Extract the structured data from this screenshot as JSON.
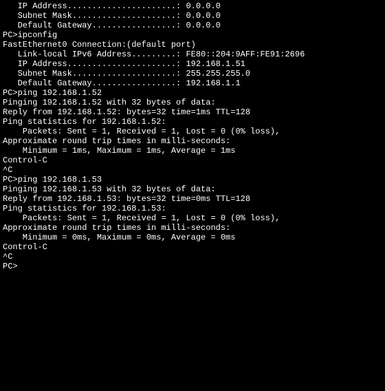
{
  "lines": {
    "l00": "",
    "l01": "   IP Address......................: 0.0.0.0",
    "l02": "   Subnet Mask.....................: 0.0.0.0",
    "l03": "   Default Gateway.................: 0.0.0.0",
    "l04": "",
    "l05": "PC>ipconfig",
    "l06": "",
    "l07": "FastEthernet0 Connection:(default port)",
    "l08": "",
    "l09": "   Link-local IPv6 Address.........: FE80::204:9AFF:FE91:2696",
    "l10": "   IP Address......................: 192.168.1.51",
    "l11": "   Subnet Mask.....................: 255.255.255.0",
    "l12": "   Default Gateway.................: 192.168.1.1",
    "l13": "",
    "l14": "PC>ping 192.168.1.52",
    "l15": "",
    "l16": "Pinging 192.168.1.52 with 32 bytes of data:",
    "l17": "",
    "l18": "Reply from 192.168.1.52: bytes=32 time=1ms TTL=128",
    "l19": "",
    "l20": "Ping statistics for 192.168.1.52:",
    "l21": "    Packets: Sent = 1, Received = 1, Lost = 0 (0% loss),",
    "l22": "Approximate round trip times in milli-seconds:",
    "l23": "    Minimum = 1ms, Maximum = 1ms, Average = 1ms",
    "l24": "",
    "l25": "Control-C",
    "l26": "^C",
    "l27": "PC>ping 192.168.1.53",
    "l28": "",
    "l29": "Pinging 192.168.1.53 with 32 bytes of data:",
    "l30": "",
    "l31": "Reply from 192.168.1.53: bytes=32 time=0ms TTL=128",
    "l32": "",
    "l33": "Ping statistics for 192.168.1.53:",
    "l34": "    Packets: Sent = 1, Received = 1, Lost = 0 (0% loss),",
    "l35": "Approximate round trip times in milli-seconds:",
    "l36": "    Minimum = 0ms, Maximum = 0ms, Average = 0ms",
    "l37": "",
    "l38": "Control-C",
    "l39": "^C",
    "l40": "PC>"
  }
}
